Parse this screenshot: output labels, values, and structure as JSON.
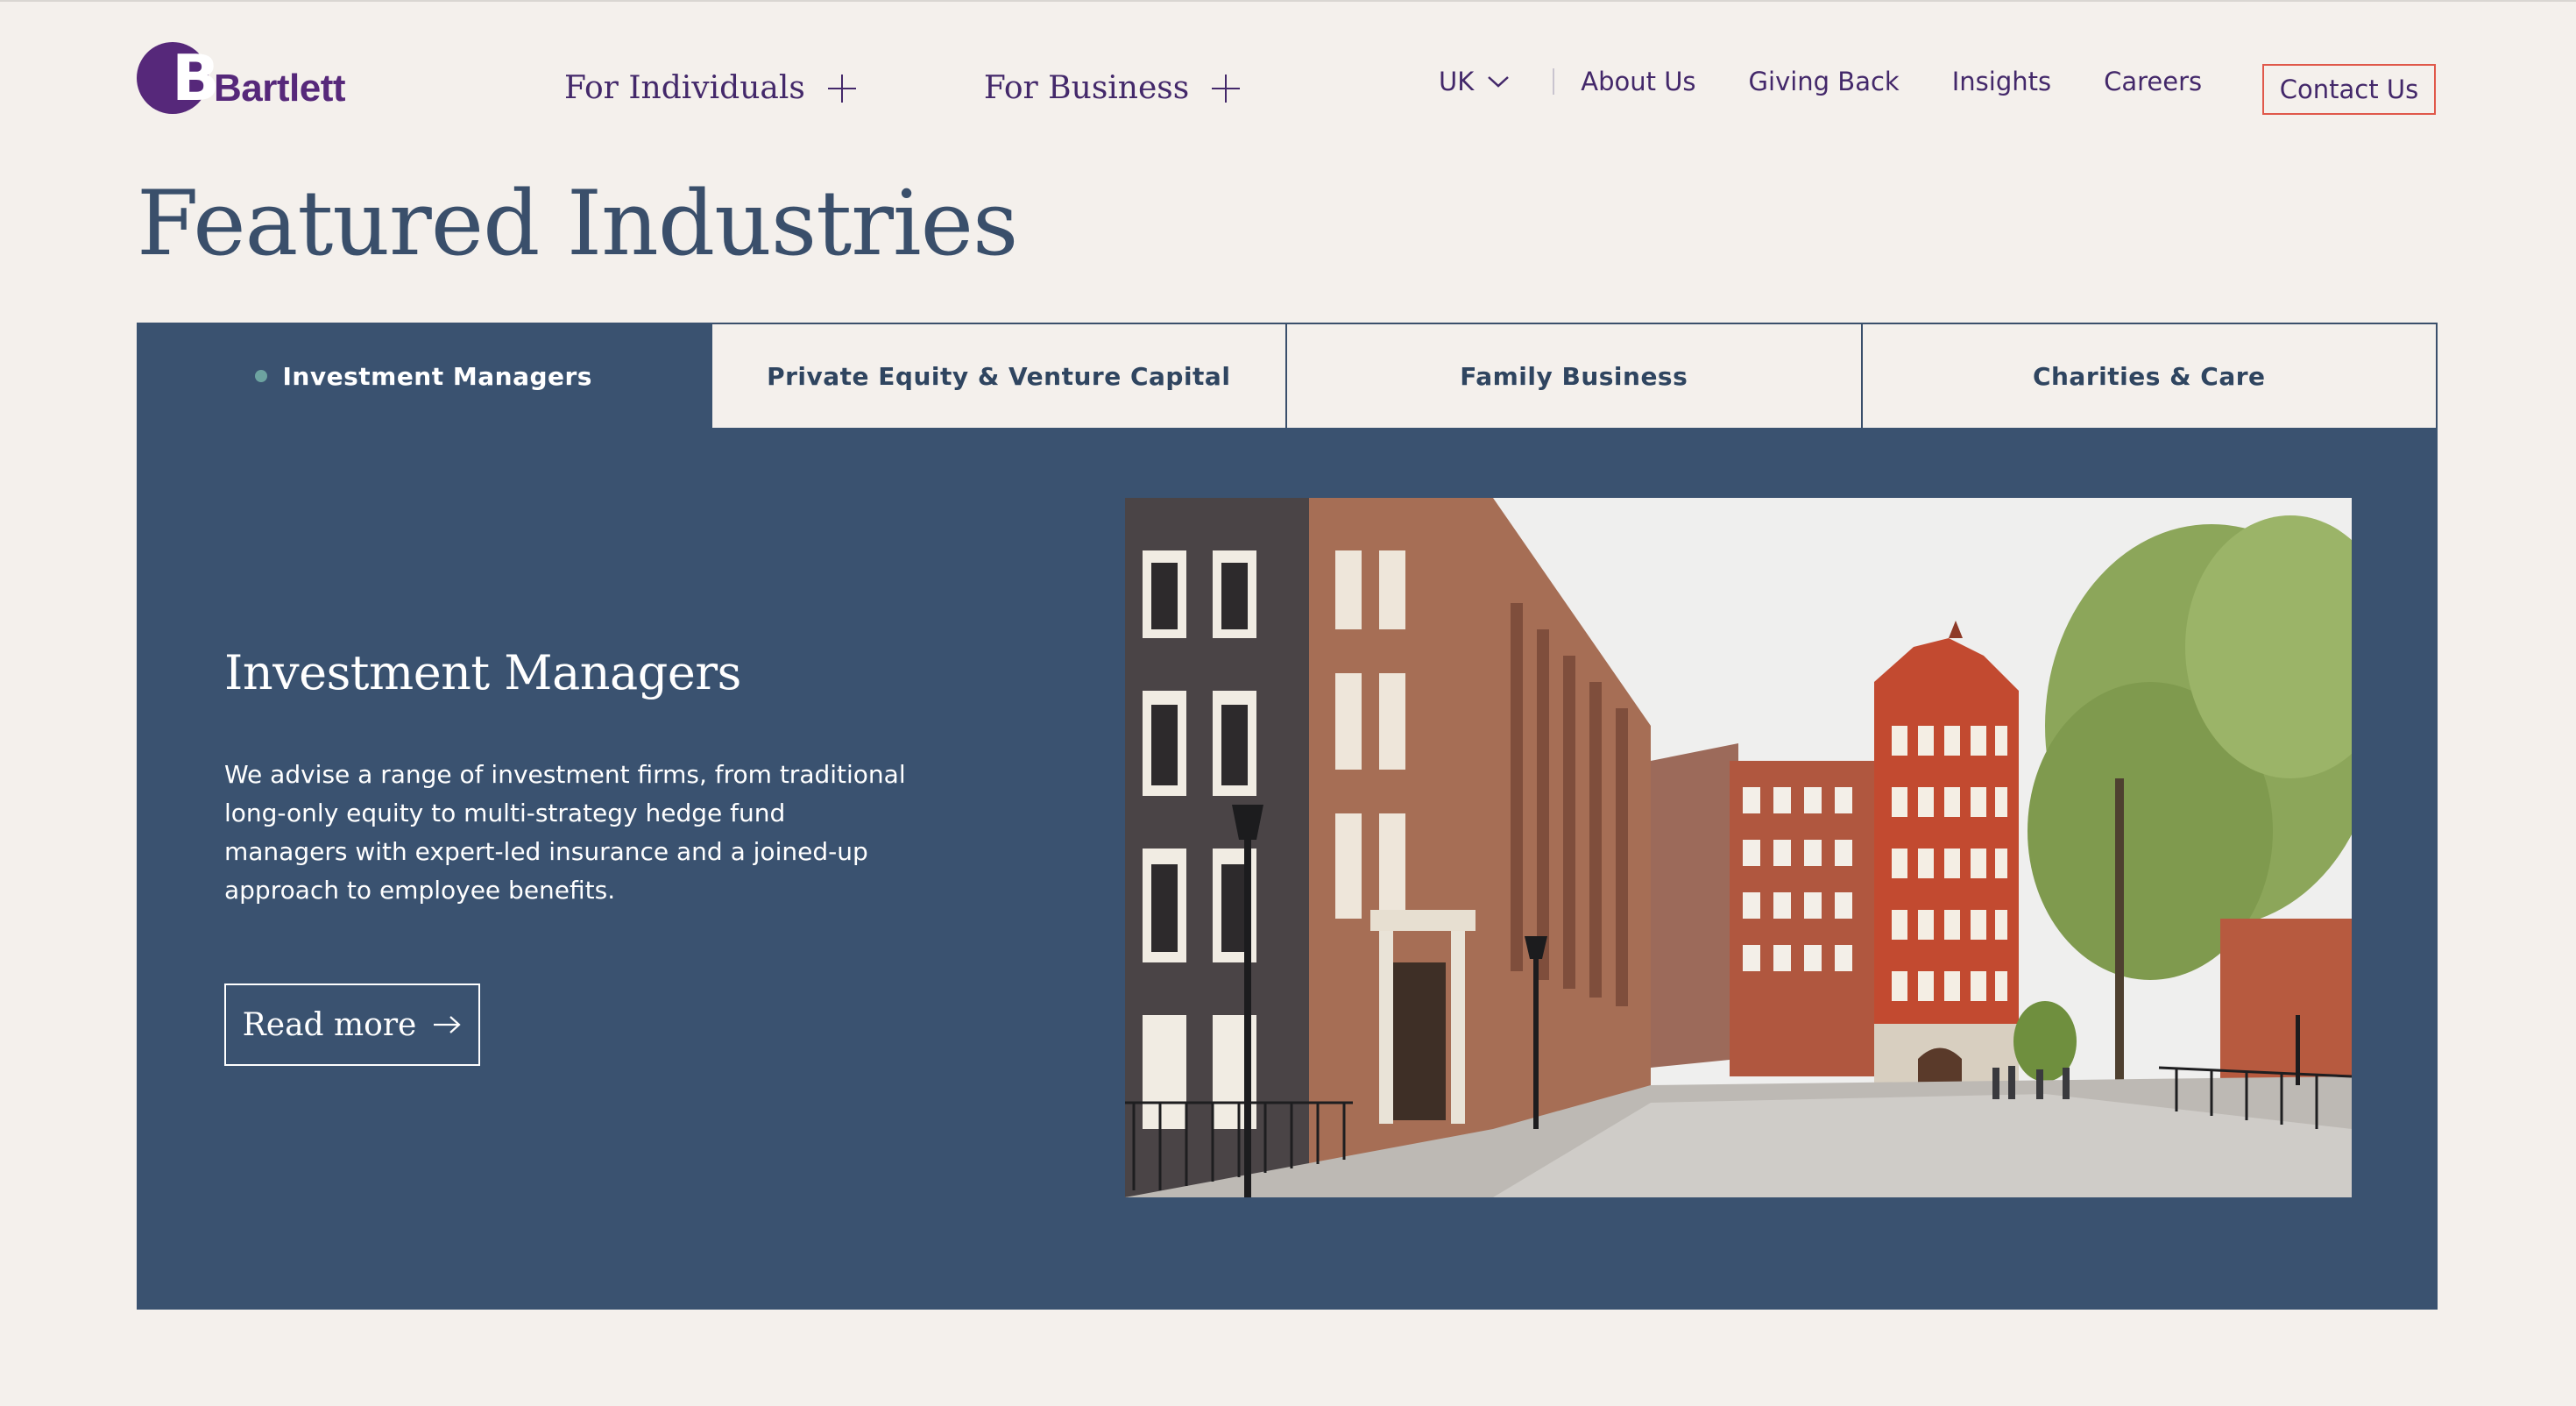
{
  "brand": {
    "name": "Bartlett",
    "logo_letter": "B",
    "color": "#56287A"
  },
  "nav": {
    "primary": [
      {
        "label": "For Individuals",
        "icon": "plus-icon"
      },
      {
        "label": "For Business",
        "icon": "plus-icon"
      }
    ],
    "region": {
      "label": "UK",
      "icon": "chevron-down-icon"
    },
    "links": [
      "About Us",
      "Giving Back",
      "Insights",
      "Careers"
    ],
    "contact": "Contact Us"
  },
  "page": {
    "title": "Featured Industries"
  },
  "tabs": [
    {
      "label": "Investment Managers",
      "active": true
    },
    {
      "label": "Private Equity & Venture Capital",
      "active": false
    },
    {
      "label": "Family Business",
      "active": false
    },
    {
      "label": "Charities & Care",
      "active": false
    }
  ],
  "panel": {
    "title": "Investment Managers",
    "description": "We advise a range of investment firms, from traditional long-only equity to multi-strategy hedge fund managers with expert-led insurance and a joined-up approach to employee benefits.",
    "cta": "Read more",
    "cta_icon": "arrow-right-icon",
    "image_alt": "London street with period buildings"
  },
  "colors": {
    "background": "#F4F0EC",
    "panel": "#3A5270",
    "heading": "#3A4F6B",
    "nav_text": "#43286A",
    "contact_border": "#E0584A",
    "tab_dot": "#6DA3A0"
  }
}
